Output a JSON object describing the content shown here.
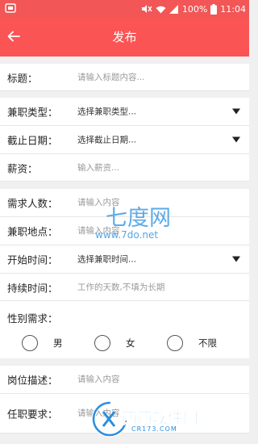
{
  "status_bar": {
    "battery": "100%",
    "time": "11:04",
    "icons": [
      "notification-icon",
      "mute-icon",
      "wifi-icon",
      "signal-icon",
      "battery-icon"
    ]
  },
  "app_bar": {
    "title": "发布",
    "back_icon": "arrow-left-icon"
  },
  "form": {
    "title": {
      "label": "标题：",
      "placeholder": "请输入标题内容..."
    },
    "job_type": {
      "label": "兼职类型：",
      "value": "选择兼职类型..."
    },
    "deadline": {
      "label": "截止日期：",
      "value": "选择截止日期..."
    },
    "salary": {
      "label": "薪资：",
      "placeholder": "输入薪资..."
    },
    "headcount": {
      "label": "需求人数：",
      "placeholder": "请输入内容"
    },
    "location": {
      "label": "兼职地点：",
      "placeholder": "请输入内容"
    },
    "start_time": {
      "label": "开始时间：",
      "value": "选择兼职时间..."
    },
    "duration": {
      "label": "持续时间：",
      "placeholder": "工作的天数,不填为长期"
    },
    "gender": {
      "label": "性别需求：",
      "options": [
        "男",
        "女",
        "不限"
      ]
    },
    "description": {
      "label": "岗位描述：",
      "placeholder": "请输入内容"
    },
    "requirements": {
      "label": "任职要求：",
      "placeholder": "请输入内容"
    }
  },
  "colors": {
    "accent": "#fb5455",
    "status_bar": "#f25656",
    "background": "#f0f0f0"
  },
  "watermarks": {
    "top_brand": "七度网",
    "top_url": "www.7do.net",
    "bottom_brand": "西西软件园",
    "bottom_url": "CR173.COM"
  }
}
